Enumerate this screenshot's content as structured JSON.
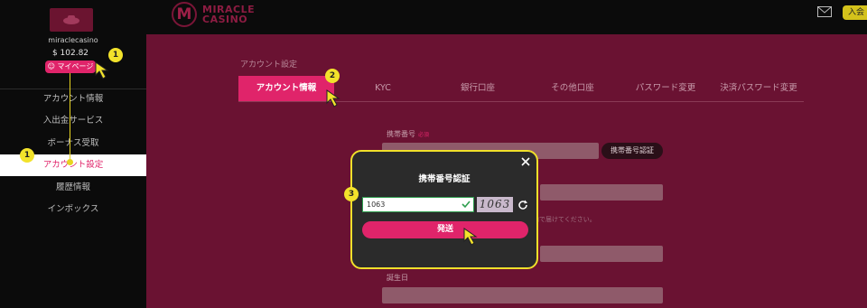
{
  "brand": {
    "logo_letter": "M",
    "name": "MIRACLE CASINO"
  },
  "header": {
    "login_label": "入会"
  },
  "sidebar": {
    "username": "miraclecasino",
    "balance": "$ 102.82",
    "mypage_label": "マイページ",
    "items": [
      {
        "label": "アカウント情報"
      },
      {
        "label": "入出金サービス"
      },
      {
        "label": "ボーナス受取"
      },
      {
        "label": "アカウント設定"
      },
      {
        "label": "履歴情報"
      },
      {
        "label": "インボックス"
      }
    ],
    "active_index": 3
  },
  "main": {
    "section_title": "アカウント設定",
    "tabs": [
      {
        "label": "アカウント情報"
      },
      {
        "label": "KYC"
      },
      {
        "label": "銀行口座"
      },
      {
        "label": "その他口座"
      },
      {
        "label": "パスワード変更"
      },
      {
        "label": "決済パスワード変更"
      }
    ],
    "phone_label": "携帯番号",
    "phone_required": "必須",
    "verify_button": "携帯番号認証",
    "hint": "内で届けてください。",
    "birthday_label": "誕生日"
  },
  "modal": {
    "title": "携帯番号認証",
    "code_value": "1063",
    "captcha_text": "1063",
    "send_label": "発送"
  },
  "annotations": {
    "badge_1": "1",
    "badge_2": "2",
    "badge_3": "3"
  },
  "colors": {
    "accent": "#e0246a",
    "highlight": "#f2e22b",
    "panel": "#6a1232",
    "sidebar": "#0b0b0b"
  }
}
